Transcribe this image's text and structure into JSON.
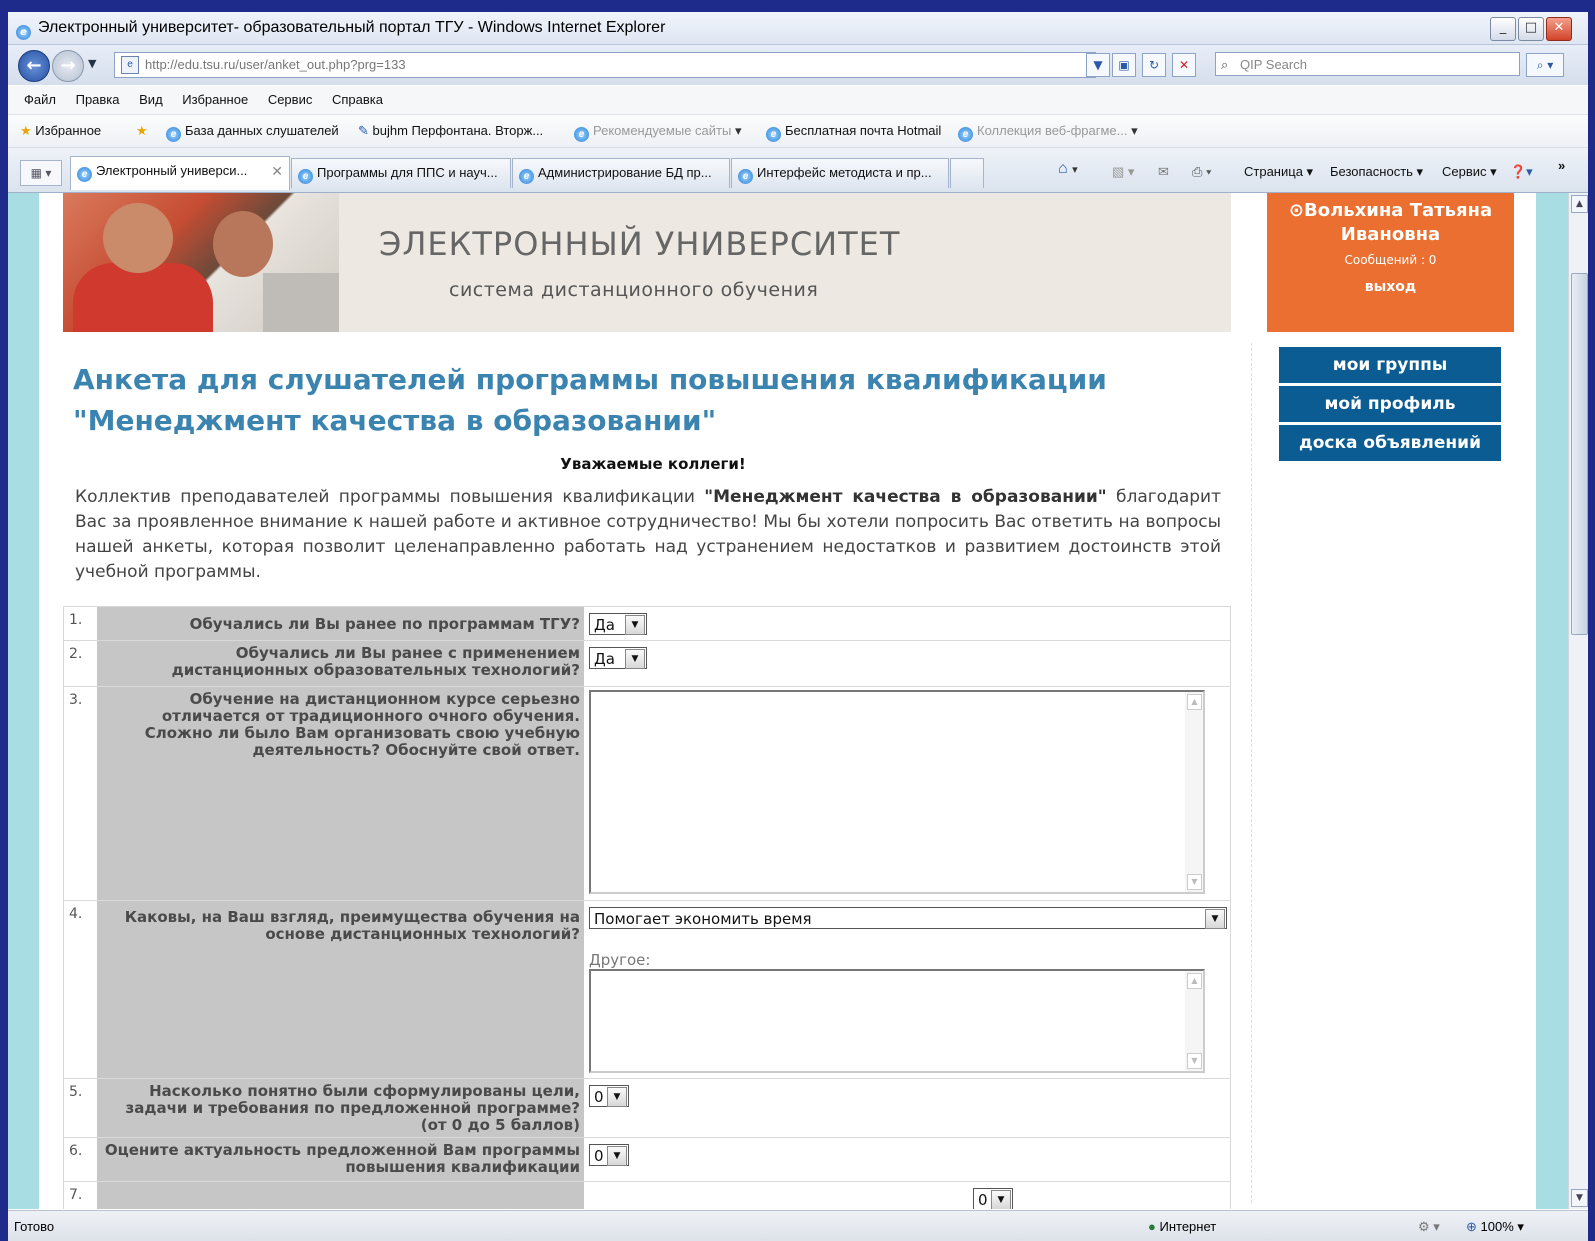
{
  "window": {
    "title": "Электронный университет- образовательный портал ТГУ - Windows Internet Explorer"
  },
  "addressbar": {
    "url": "http://edu.tsu.ru/user/anket_out.php?prg=133",
    "search_placeholder": "QIP Search"
  },
  "menu": [
    "Файл",
    "Правка",
    "Вид",
    "Избранное",
    "Сервис",
    "Справка"
  ],
  "favorites": {
    "label": "Избранное",
    "items": [
      "База данных слушателей",
      "bujhm Перфонтана. Вторж...",
      "Рекомендуемые сайты",
      "Бесплатная почта Hotmail",
      "Коллекция веб-фрагме..."
    ]
  },
  "tabs": [
    "Электронный универси...",
    "Программы для ППС и науч...",
    "Администрирование БД пр...",
    "Интерфейс методиста и пр..."
  ],
  "commandbar": {
    "page": "Страница",
    "safety": "Безопасность",
    "tools": "Сервис"
  },
  "header": {
    "title": "ЭЛЕКТРОННЫЙ УНИВЕРСИТЕТ",
    "subtitle": "система дистанционного обучения"
  },
  "user": {
    "name": "Вольхина Татьяна Ивановна",
    "messages": "Сообщений : 0",
    "logout": "выход"
  },
  "nav": [
    "мои группы",
    "мой профиль",
    "доска объявлений"
  ],
  "page": {
    "title": "Анкета для слушателей программы повышения квалификации \"Менеджмент качества в образовании\"",
    "greeting": "Уважаемые коллеги!",
    "intro_1": "Коллектив преподавателей программы повышения квалификации ",
    "intro_bold": "\"Менеджмент качества в образовании\"",
    "intro_2": " благодарит Вас за проявленное внимание к нашей работе и активное сотрудничество! Мы бы хотели попросить Вас ответить на вопросы нашей анкеты, которая позволит целенаправленно работать над устранением недостатков и развитием достоинств этой учебной программы."
  },
  "questions": [
    {
      "num": "1.",
      "text": "Обучались ли Вы ранее по программам ТГУ?",
      "value": "Да"
    },
    {
      "num": "2.",
      "text": "Обучались ли Вы ранее с применением дистанционных образовательных технологий?",
      "value": "Да"
    },
    {
      "num": "3.",
      "text": "Обучение на дистанционном курсе серьезно отличается от традиционного очного обучения. Сложно ли было Вам организовать свою учебную деятельность? Обоснуйте свой ответ.",
      "value": ""
    },
    {
      "num": "4.",
      "text": "Каковы, на Ваш взгляд, преимущества обучения на основе дистанционных технологий?",
      "value": "Помогает экономить время",
      "other_label": "Другое:"
    },
    {
      "num": "5.",
      "text": "Насколько понятно были сформулированы цели, задачи и требования по предложенной программе? (от 0 до 5 баллов)",
      "value": "0"
    },
    {
      "num": "6.",
      "text": "Оцените актуальность предложенной Вам программы повышения квалификации",
      "value": "0"
    },
    {
      "num": "7.",
      "text": "",
      "value": "0"
    }
  ],
  "statusbar": {
    "status": "Готово",
    "zone": "Интернет",
    "zoom": "100%"
  }
}
